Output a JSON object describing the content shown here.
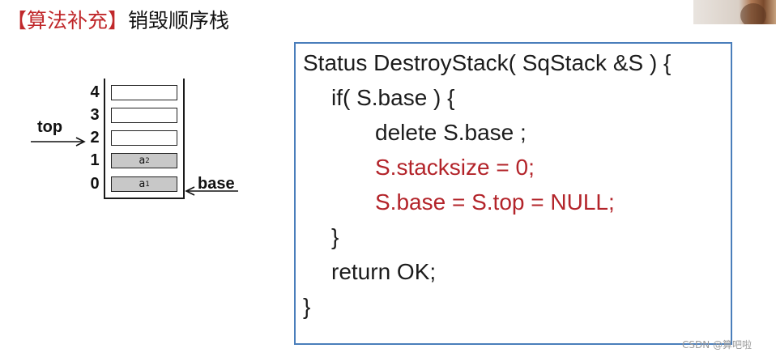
{
  "slide": {
    "title_tag": "【算法补充】",
    "title_text": "销毁顺序栈",
    "watermark": "CSDN @算吧啦"
  },
  "stack_diagram": {
    "indices": [
      "4",
      "3",
      "2",
      "1",
      "0"
    ],
    "cells": [
      {
        "index": "4",
        "value": "",
        "sub": "",
        "filled": false
      },
      {
        "index": "3",
        "value": "",
        "sub": "",
        "filled": false
      },
      {
        "index": "2",
        "value": "",
        "sub": "",
        "filled": false
      },
      {
        "index": "1",
        "value": "a",
        "sub": "2",
        "filled": true
      },
      {
        "index": "0",
        "value": "a",
        "sub": "1",
        "filled": true
      }
    ],
    "top_label": "top",
    "base_label": "base"
  },
  "code": {
    "lines": [
      {
        "text": "Status DestroyStack( SqStack &S ) {",
        "indent": 0,
        "highlight": false
      },
      {
        "text": "if( S.base ) {",
        "indent": 1,
        "highlight": false
      },
      {
        "text": "delete S.base ;",
        "indent": 2,
        "highlight": false
      },
      {
        "text": "S.stacksize = 0;",
        "indent": 2,
        "highlight": true
      },
      {
        "text": "S.base = S.top = NULL;",
        "indent": 2,
        "highlight": true
      },
      {
        "text": "}",
        "indent": 1,
        "highlight": false
      },
      {
        "text": "return OK;",
        "indent": 1,
        "highlight": false
      },
      {
        "text": "}",
        "indent": 0,
        "highlight": false
      }
    ]
  },
  "colors": {
    "highlight": "#b3242a",
    "code_border": "#4a7ebb",
    "cell_fill": "#c8c8c8"
  }
}
